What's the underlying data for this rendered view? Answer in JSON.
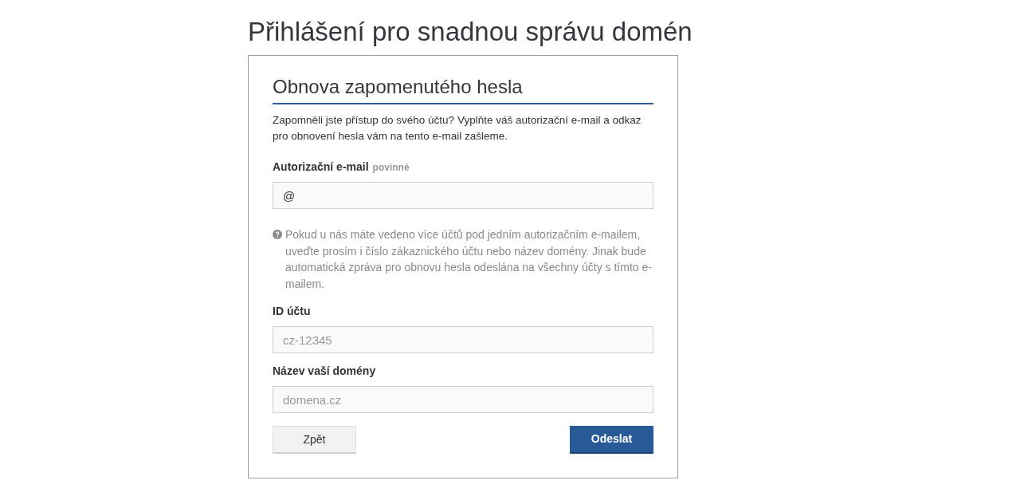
{
  "page_title": "Přihlášení pro snadnou správu domén",
  "card": {
    "title": "Obnova zapomenutého hesla",
    "intro": "Zapomněli jste přístup do svého účtu? Vyplňte váš autorizační e-mail a odkaz pro obnovení hesla vám na tento e-mail zašleme.",
    "fields": [
      {
        "label": "Autorizační e-mail",
        "required_tag": "povinné",
        "value": "@"
      },
      {
        "kind": "hint",
        "text": "Pokud u nás máte vedeno více účtů pod jedním autorizačním e-mailem, uveďte prosím i číslo zákaznického účtu nebo název domény. Jinak bude automatická zpráva pro obnovu hesla odeslána na všechny účty s tímto e-mailem."
      },
      {
        "label": "ID účtu",
        "placeholder": "cz-12345"
      },
      {
        "label": "Název vaší domény",
        "placeholder": "domena.cz"
      }
    ],
    "buttons": [
      {
        "label": "Zpět",
        "kind": "secondary"
      },
      {
        "label": "Odeslat",
        "kind": "primary"
      }
    ]
  }
}
